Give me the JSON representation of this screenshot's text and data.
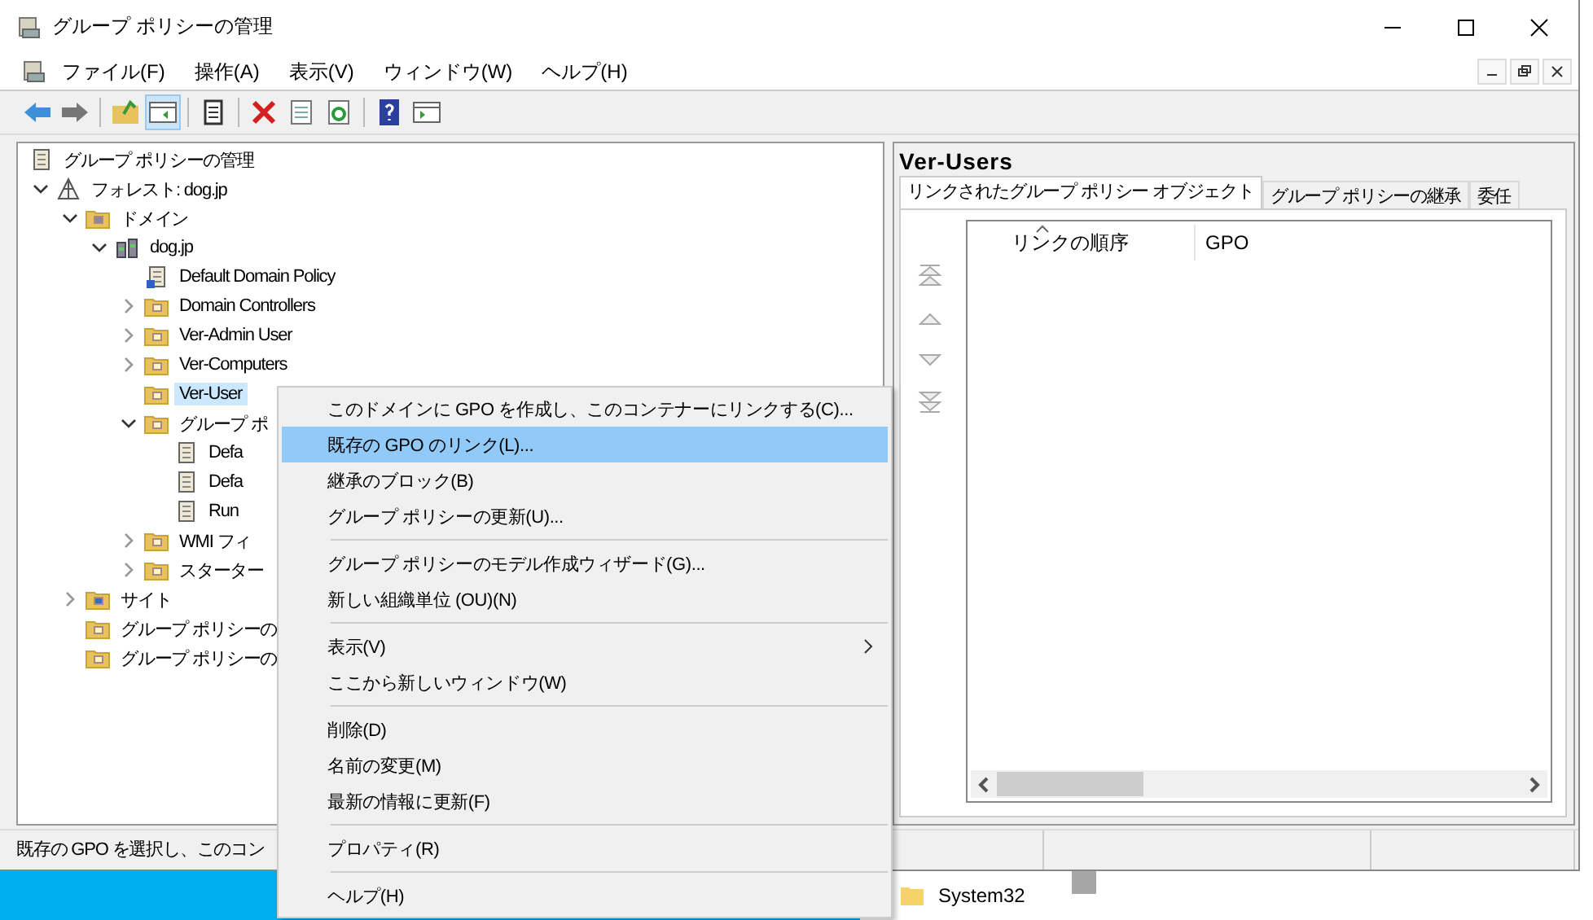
{
  "window": {
    "title": "グループ ポリシーの管理"
  },
  "menu_bar": [
    "ファイル(F)",
    "操作(A)",
    "表示(V)",
    "ウィンドウ(W)",
    "ヘルプ(H)"
  ],
  "toolbar": [
    {
      "kind": "back",
      "pressed": false
    },
    {
      "kind": "forward",
      "pressed": false
    },
    {
      "kind": "sep"
    },
    {
      "kind": "up",
      "pressed": false
    },
    {
      "kind": "pane",
      "pressed": true
    },
    {
      "kind": "sep"
    },
    {
      "kind": "clipboard",
      "pressed": false
    },
    {
      "kind": "sep"
    },
    {
      "kind": "delete",
      "pressed": false
    },
    {
      "kind": "properties",
      "pressed": false
    },
    {
      "kind": "refresh",
      "pressed": false
    },
    {
      "kind": "sep"
    },
    {
      "kind": "help",
      "pressed": false
    },
    {
      "kind": "panel",
      "pressed": false
    }
  ],
  "tree": [
    {
      "label": "グループ ポリシーの管理",
      "kind": "gpm",
      "selected": false,
      "children": [
        {
          "label": "フォレスト: dog.jp",
          "kind": "forest",
          "selected": false,
          "expanded": true,
          "children": [
            {
              "label": "ドメイン",
              "kind": "domains",
              "selected": false,
              "expanded": true,
              "children": [
                {
                  "label": "dog.jp",
                  "kind": "domain",
                  "selected": false,
                  "expanded": true,
                  "children": [
                    {
                      "label": "Default Domain Policy",
                      "kind": "gpo-link",
                      "selected": false
                    },
                    {
                      "label": "Domain Controllers",
                      "kind": "ou",
                      "selected": false,
                      "expanded": false
                    },
                    {
                      "label": "Ver-Admin User",
                      "kind": "ou",
                      "selected": false,
                      "expanded": false
                    },
                    {
                      "label": "Ver-Computers",
                      "kind": "ou",
                      "selected": false,
                      "expanded": false
                    },
                    {
                      "label": "Ver-User",
                      "kind": "ou",
                      "selected": true
                    },
                    {
                      "label": "グループ ポ",
                      "kind": "gpo-folder",
                      "selected": false,
                      "expanded": true,
                      "children": [
                        {
                          "label": "Defa",
                          "kind": "gpo",
                          "selected": false
                        },
                        {
                          "label": "Defa",
                          "kind": "gpo",
                          "selected": false
                        },
                        {
                          "label": "Run",
                          "kind": "gpo",
                          "selected": false
                        }
                      ]
                    },
                    {
                      "label": "WMI フィ",
                      "kind": "wmi",
                      "selected": false,
                      "expanded": false
                    },
                    {
                      "label": "スターター",
                      "kind": "starter",
                      "selected": false,
                      "expanded": false
                    }
                  ]
                }
              ]
            },
            {
              "label": "サイト",
              "kind": "sites",
              "selected": false,
              "expanded": false
            },
            {
              "label": "グループ ポリシーの",
              "kind": "modeling",
              "selected": false
            },
            {
              "label": "グループ ポリシーの",
              "kind": "results",
              "selected": false
            }
          ]
        }
      ]
    }
  ],
  "details": {
    "title": "Ver-Users",
    "tabs": [
      {
        "label": "リンクされたグループ ポリシー オブジェクト",
        "selected": true
      },
      {
        "label": "グループ ポリシーの継承",
        "selected": false
      },
      {
        "label": "委任",
        "selected": false
      }
    ],
    "columns": [
      {
        "label": "リンクの順序",
        "sorted": true
      },
      {
        "label": "GPO",
        "sorted": false
      }
    ],
    "order_buttons": [
      {
        "kind": "top",
        "disabled": true
      },
      {
        "kind": "up",
        "disabled": true
      },
      {
        "kind": "down",
        "disabled": true
      },
      {
        "kind": "bottom",
        "disabled": true
      }
    ]
  },
  "status_bar": "既存の GPO を選択し、このコン",
  "context_menu": [
    [
      {
        "label": "このドメインに GPO を作成し、このコンテナーにリンクする(C)...",
        "selected": false
      },
      {
        "label": "既存の GPO のリンク(L)...",
        "selected": true
      },
      {
        "label": "継承のブロック(B)",
        "selected": false
      },
      {
        "label": "グループ ポリシーの更新(U)...",
        "selected": false
      }
    ],
    [
      {
        "label": "グループ ポリシーのモデル作成ウィザード(G)...",
        "selected": false
      },
      {
        "label": "新しい組織単位 (OU)(N)",
        "selected": false
      }
    ],
    [
      {
        "label": "表示(V)",
        "selected": false,
        "submenu": true
      },
      {
        "label": "ここから新しいウィンドウ(W)",
        "selected": false
      }
    ],
    [
      {
        "label": "削除(D)",
        "selected": false
      },
      {
        "label": "名前の変更(M)",
        "selected": false
      },
      {
        "label": "最新の情報に更新(F)",
        "selected": false
      }
    ],
    [
      {
        "label": "プロパティ(R)",
        "selected": false
      }
    ],
    [
      {
        "label": "ヘルプ(H)",
        "selected": false
      }
    ]
  ],
  "background_window": {
    "folder": "System32"
  }
}
